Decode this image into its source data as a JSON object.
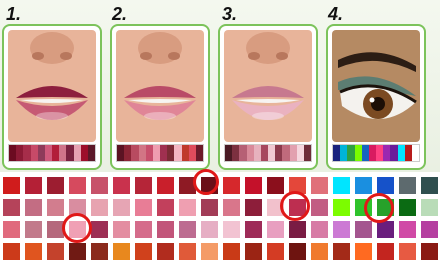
{
  "labels": [
    "1.",
    "2.",
    "3.",
    "4."
  ],
  "colors": {
    "card_border": "#7cc35b",
    "highlight_ring": "#e01818"
  },
  "cards": [
    {
      "name": "lipstick-1",
      "strip": [
        "#6b0b21",
        "#8c1a35",
        "#a62d4a",
        "#c74a68",
        "#8e3b5a",
        "#d05a7c",
        "#b21e3a",
        "#d0748a",
        "#7a2240",
        "#e6a1b2",
        "#9d0f2b",
        "#5b1828"
      ]
    },
    {
      "name": "lipstick-2",
      "strip": [
        "#5b1323",
        "#8b2435",
        "#b84b60",
        "#d27585",
        "#c84f6c",
        "#ef9db0",
        "#a03050",
        "#7c2b35",
        "#f3b6c2",
        "#c0392b",
        "#e04c5c",
        "#6c1a2a"
      ]
    },
    {
      "name": "lipstick-3",
      "strip": [
        "#4a1a24",
        "#7c3040",
        "#b66075",
        "#d98a9a",
        "#e7b2be",
        "#a7485f",
        "#f0c9d2",
        "#8b3a4c",
        "#c06a7c",
        "#e2a0af",
        "#f5d6de",
        "#6e2c39"
      ]
    },
    {
      "name": "eyeshadow-4",
      "strip": [
        "#1a237e",
        "#00b4d8",
        "#2ea043",
        "#7cfc00",
        "#1565c0",
        "#d81b60",
        "#ff4081",
        "#9c27b0",
        "#6a1b9a",
        "#00e5ff",
        "#b71c1c",
        "#ffffff"
      ]
    }
  ],
  "swatch_rows": [
    [
      "#d01c1c",
      "#b42036",
      "#9c1d30",
      "#d64a5e",
      "#c7526a",
      "#c9324d",
      "#b52538",
      "#c91f2b",
      "#8e1a24",
      "#6b0f18",
      "#d6282c",
      "#c4112a",
      "#8b0f1c",
      "#e4473a",
      "#e0707a",
      "#00e5ff",
      "#1a8fe0",
      "#1652c9",
      "#5d6a6e",
      "#2f4f4f"
    ],
    [
      "#b5435a",
      "#c36d83",
      "#d27d8e",
      "#d98da0",
      "#e7a3b0",
      "#e6a5b4",
      "#e87d96",
      "#c2405c",
      "#ef9fb1",
      "#a23c57",
      "#d9768b",
      "#8d1e3a",
      "#f2c1cc",
      "#bd2e50",
      "#c25d83",
      "#7cfc00",
      "#2fc32c",
      "#27a12a",
      "#0b6b13",
      "#b9dcb8"
    ],
    [
      "#e06a7d",
      "#c27a8b",
      "#b5687c",
      "#f0a0b5",
      "#9d2f55",
      "#e38da1",
      "#d56c8b",
      "#c2557a",
      "#bd6c91",
      "#e6aec4",
      "#f2c3d2",
      "#9e2b58",
      "#e89fc0",
      "#7a1c44",
      "#d77ba5",
      "#cc7ad4",
      "#a4558f",
      "#6a1e7d",
      "#d04aa6",
      "#b53fa0"
    ],
    [
      "#cc3a1a",
      "#e0551f",
      "#c4422c",
      "#701a14",
      "#8b2a1c",
      "#e8881e",
      "#d0411c",
      "#b12c1e",
      "#e05a39",
      "#f49b67",
      "#c93a17",
      "#9b2414",
      "#d43c24",
      "#6e1410",
      "#f07a2e",
      "#a32a18",
      "#ff6a21",
      "#c3251f",
      "#e75a42",
      "#8a1a14"
    ]
  ],
  "highlight_rings": [
    {
      "name": "highlight-ring-1"
    },
    {
      "name": "highlight-ring-2"
    },
    {
      "name": "highlight-ring-3"
    },
    {
      "name": "highlight-ring-4"
    }
  ]
}
